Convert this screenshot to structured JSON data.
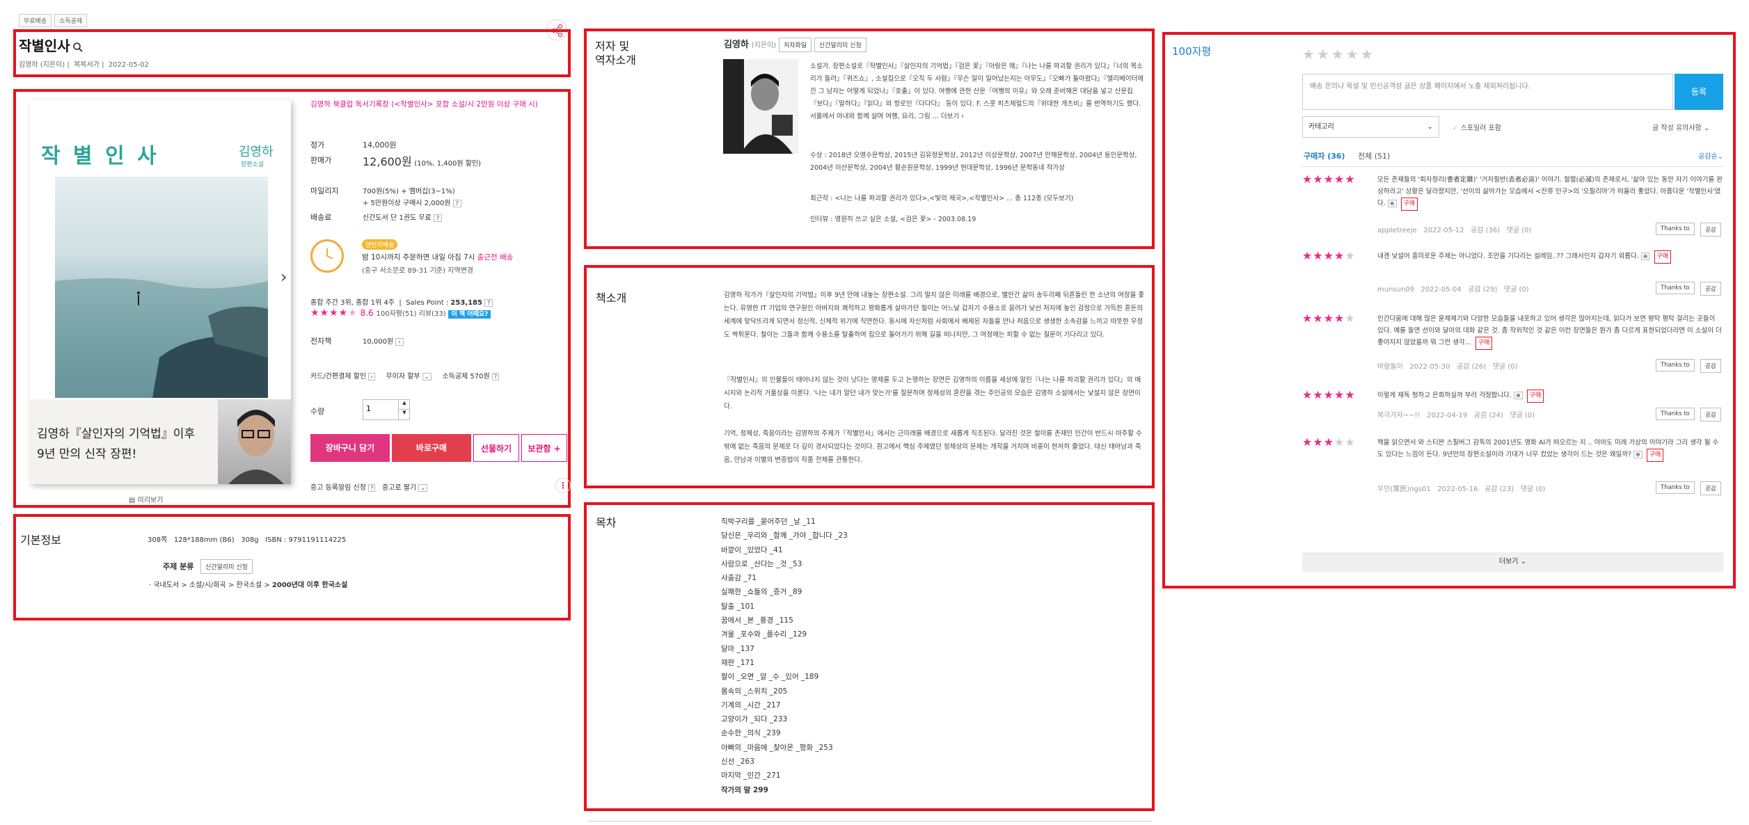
{
  "top_tags": [
    "무료배송",
    "소득공제"
  ],
  "title": "작별인사",
  "author_line": {
    "author": "김영하 (지은이)",
    "publisher": "복복서가",
    "date": "2022-05-02"
  },
  "cover": {
    "title_art": "작 별 인 사",
    "author": "김영하",
    "subtitle": "장편소설",
    "ad_line1": "김영하『살인자의 기억법』이후",
    "ad_line2": "9년 만의 신작 장편!",
    "preview_label": "미리보기"
  },
  "promo_text": "김영하 북클럽 독서기록장 (<작별인사> 포함 소설/시 2만원 이상 구매 시)",
  "price": {
    "list_label": "정가",
    "list_value": "14,000원",
    "sale_label": "판매가",
    "sale_value": "12,600원",
    "sale_note": "(10%, 1,400원 할인)",
    "mileage_label": "마일리지",
    "mileage_value": "700원(5%) + 멤버십(3~1%)",
    "mileage_sub": "+ 5만원이상 구매시 2,000원",
    "shipping_label": "배송료",
    "shipping_value": "신간도서 단 1권도 무료"
  },
  "delivery": {
    "badge": "양탄자배송",
    "line1_pre": "밤 10시까지 주문하면 내일 아침 7시 ",
    "line1_link": "출근전 배송",
    "line2": "(중구 서소문로 89-31 기준) 지역변경"
  },
  "ranking": {
    "text": "종합 주간 3위, 종합 1위 4주",
    "sales_label": "Sales Point : ",
    "sales_value": "253,185",
    "rating": "8.6",
    "review_counts": "100자평(51)  리뷰(33)",
    "fun_badge": "이 책 어때요?",
    "rating_stars": 4.5
  },
  "ebook": {
    "label": "전자책",
    "value": "10,000원"
  },
  "payment": {
    "card": "카드/간편결제 할인",
    "installment": "무이자 할부",
    "tax": "소득공제 570원"
  },
  "quantity": {
    "label": "수량",
    "value": "1"
  },
  "buttons": {
    "cart": "장바구니 담기",
    "buy": "바로구매",
    "gift": "선물하기",
    "store": "보관함 +"
  },
  "used": {
    "alert": "중고 등록알림 신청",
    "sell": "중고로 팔기"
  },
  "basic_info": {
    "title": "기본정보",
    "specs": "308쪽   128*188mm (B6)   308g   ISBN : 9791191114225",
    "subject_label": "주제 분류",
    "subject_btn": "신간알리미 신청",
    "category_path": "국내도서 > 소설/시/희곡 > 한국소설 > ",
    "category_last": "2000년대 이후 한국소설"
  },
  "author_section": {
    "title_line1": "저자 및",
    "title_line2": "역자소개",
    "name": "김영하",
    "role": "(지은이)",
    "btn_file": "저자파일",
    "btn_alert": "신간알리미 신청",
    "bio": "소설가. 장편소설로『작별인사』『살인자의 기억법』『검은 꽃』『아랑은 왜』『나는 나를 파괴할 권리가 있다』『너의 목소리가 들려』『퀴즈쇼』, 소설집으로『오직 두 사람』『무슨 일이 일어났는지는 아무도』『오빠가 돌아왔다』『엘리베이터에 낀 그 남자는 어떻게 되었나』『호출』이 있다. 여행에 관한 산문『여행의 이유』와 오래 준비해온 대담을 넣고 산문집『보다』『말하다』『읽다』와 항로인『다다다』 등이 있다. F. 스콧 피츠제럴드의『위대한 개츠비』를 번역하기도 했다. 서울에서 아내와 함께 살며 여행, 요리, 그림 ... 더보기 ›",
    "awards": "수상 : 2018년 오영수문학상, 2015년 김유정문학상, 2012년 이상문학상, 2007년 만해문학상, 2004년 동인문학상, 2004년 이산문학상, 2004년 황순원문학상, 1999년 현대문학상, 1996년 문학동네 작가상",
    "recent": "최근작 : <나는 나를 파괴할 권리가 있다>,<빛의 제국>,<작별인사> ... 총 112종 (모두보기)",
    "interview": "인터뷰 : 영원히 쓰고 싶은 소설, <검은 꽃> - 2003.08.19"
  },
  "book_intro": {
    "title": "책소개",
    "p1": "김영하 작가가『살인자의 기억법』이후 9년 만에 내놓는 장편소설. 그리 멀지 않은 미래를 배경으로, 별안간 삶이 송두리째 뒤흔들린 한 소년의 여정을 좇는다. 유명한 IT 기업의 연구원인 아버지와 쾌적하고 평화롭게 살아가던 철이는 어느날 갑자기 수용소로 끌려가 낯선 처지에 놓인 감정으로 가득한 혼돈의 세계에 맞닥뜨리게 되면서 정신적, 신체적 위기에 직면한다. 동시에 자신처럼 사회에서 배제된 자들을 만나 처음으로 생생한 소속감을 느끼고 따뜻한 우정도 싹튀운다. 철이는 그들과 함께 수용소를 탈출하여 집으로 돌아가기 위해 길을 떠나지만, 그 여정에는 피할 수 없는 질문이 기다리고 있다.",
    "p2": "『작별인사』의 인물들이 태어나지 않는 것이 낫다는 명제를 두고 논쟁하는 장면은 김영하의 이름을 세상에 알린『나는 나를 파괴할 권리가 있다』의 메시지와 논리적 거울상을 이룬다. '나는 내가 알던 내가 맞는가'를 질문하며 정체성의 혼란을 겪는 주인공의 모습은 김영하 소설에서는 낯설지 않은 장면이다.",
    "p3": "기억, 정체성, 죽음이라는 김영하의 주제가『작별인사』에서는 근미래를 배경으로 새롭게 직조된다. 달라진 것은 철이를 존재인 인간이 반드시 마주할 수밖에 없는 죽음의 문제로 더 깊이 경사되었다는 것이다. 원고에서 핵심 주제였던 정체성의 문제는 개작을 거치며 비중이 현저히 줄었다. 대신 태어남과 죽음, 만남과 이별의 변증법이 작품 전체를 관통한다."
  },
  "toc": {
    "title": "목차",
    "items": [
      "직박구리를 _묻어주던 _날 _11",
      "당신은 _우리와 _함께 _가야 _합니다 _23",
      "바깥이 _있었다 _41",
      "사람으로 _산다는 _것 _53",
      "사출감 _71",
      "실패한 _쇼들의 _증거 _89",
      "탈출 _101",
      "꿈에서 _본 _풍경 _115",
      "겨울 _포수와 _플수리 _129",
      "달마 _137",
      "재판 _171",
      "팔이 _오면 _알 _수 _있어 _189",
      "몸속의 _스위치 _205",
      "기계의 _시간 _217",
      "고양이가 _되다 _233",
      "순수한 _의식 _239",
      "아빠의 _마음에 _찾아온 _평화 _253",
      "신선 _263",
      "마지막 _인간 _271",
      "작가의 말 299"
    ]
  },
  "reviews": {
    "title": "100자평",
    "input_placeholder": "배송 문의나 욕설 및 인신공격성 글은 상품 페이지에서 노출 제외처리됩니다.",
    "submit": "등록",
    "category_select": "카테고리",
    "spoiler": "스포일러 포함",
    "guide": "글 작성 유의사항",
    "tab_buyer": "구매자 (36)",
    "tab_all": "전체 (51)",
    "sort": "공감순",
    "buy_tag": "구매",
    "thanks": "Thanks to",
    "like": "공감",
    "more": "더보기",
    "items": [
      {
        "stars": 5,
        "text": "모든 존재들의 '회자정리(會者定離)' '거자필반(去者必返)' 이야기. 철렬(必滅)의 존재로서, '삶아 있는 동안 자기 이야기를 완성하라고' 상황은 달라졌지만, '선이의 삶아가는 모습에서 <잔류 인구>의 '오필리아'가 떠올라 좋았다. 아름다운 '작별인사'였다.",
        "user": "appletreeje",
        "date": "2022-05-12",
        "likes": "공감 (36)",
        "comments": "댓글 (0)"
      },
      {
        "stars": 4,
        "text": "내겐 낯설어 흥미로운 주제는 아니었다. 조만을 기다리는 설레임..?? 그래서인지 갑자기 외롭다.",
        "user": "munsun09",
        "date": "2022-05-04",
        "likes": "공감 (29)",
        "comments": "댓글 (0)"
      },
      {
        "stars": 4,
        "text": "인간다움에 대해 많은 윤체제기와 다양한 모습들을 내포하고 있어 생각은 많아지는데, 읽다가 보면 평탁 평탁 걸리는 곳들이 있다. 예를 들면 선이와 달마의 대화 같은 것. 좀 작위적인 것 같은 이런 장면들은 뭔가 좀 다르게 표현되었더라면 이 소설이 더 좋아지지 않았을까 뭐 그런 생각...",
        "user": "바람돌이",
        "date": "2022-05-30",
        "likes": "공감 (26)",
        "comments": "댓글 (0)"
      },
      {
        "stars": 5,
        "text": "이렇게 재독 청하고 은희하실까 부러 걱정합니다.",
        "user": "북극가자~~!!",
        "date": "2022-04-19",
        "likes": "공감 (24)",
        "comments": "댓글 (0)"
      },
      {
        "stars": 3,
        "text": "책을 읽으면서 와 스티븐 스필버그 감독의 2001년도 영화 AI가 떠오르는 지 .. 아마도 미래 가상의 이야기라 그리 생각 될 수도 있다는 느낌이 든다. 9년만의 장편소설이라 기대가 너무 컸었는 생각이 드는 것은 왜일까?",
        "user": "우민(寓民)ngs01",
        "date": "2022-05-16",
        "likes": "공감 (23)",
        "comments": "댓글 (0)"
      }
    ]
  }
}
